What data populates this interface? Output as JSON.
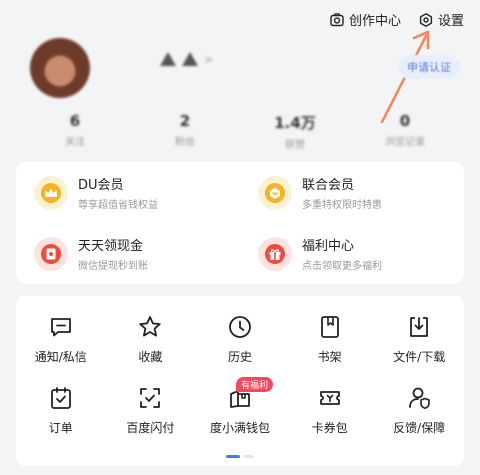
{
  "topbar": {
    "creator_center": "创作中心",
    "settings": "设置"
  },
  "profile": {
    "apply_certify": "申请认证"
  },
  "stats": [
    {
      "value": "6",
      "label": "关注"
    },
    {
      "value": "2",
      "label": "粉丝"
    },
    {
      "value": "1.4万",
      "label": "获赞"
    },
    {
      "value": "0",
      "label": "浏览记录"
    }
  ],
  "members": [
    {
      "title": "DU会员",
      "subtitle": "尊享超值省钱权益",
      "icon": "crown-icon",
      "color": "#f4b227"
    },
    {
      "title": "联合会员",
      "subtitle": "多重特权限时特惠",
      "icon": "union-member-icon",
      "color": "#f4b227"
    },
    {
      "title": "天天领现金",
      "subtitle": "微信提现秒到账",
      "icon": "cash-envelope-icon",
      "color": "#f24a3c"
    },
    {
      "title": "福利中心",
      "subtitle": "点击领取更多福利",
      "icon": "gift-icon",
      "color": "#f24a3c"
    }
  ],
  "services": [
    {
      "label": "通知/私信",
      "icon": "message-icon"
    },
    {
      "label": "收藏",
      "icon": "star-icon"
    },
    {
      "label": "历史",
      "icon": "clock-icon"
    },
    {
      "label": "书架",
      "icon": "bookshelf-icon"
    },
    {
      "label": "文件/下载",
      "icon": "download-icon"
    },
    {
      "label": "订单",
      "icon": "order-icon"
    },
    {
      "label": "百度闪付",
      "icon": "scan-pay-icon"
    },
    {
      "label": "度小满钱包",
      "icon": "wallet-icon",
      "badge": "有福利"
    },
    {
      "label": "卡券包",
      "icon": "ticket-icon"
    },
    {
      "label": "反馈/保障",
      "icon": "feedback-icon"
    }
  ],
  "colors": {
    "accent_blue": "#4a78f0",
    "badge_red": "#f24a5c",
    "annotation_arrow": "#f08a5d"
  }
}
